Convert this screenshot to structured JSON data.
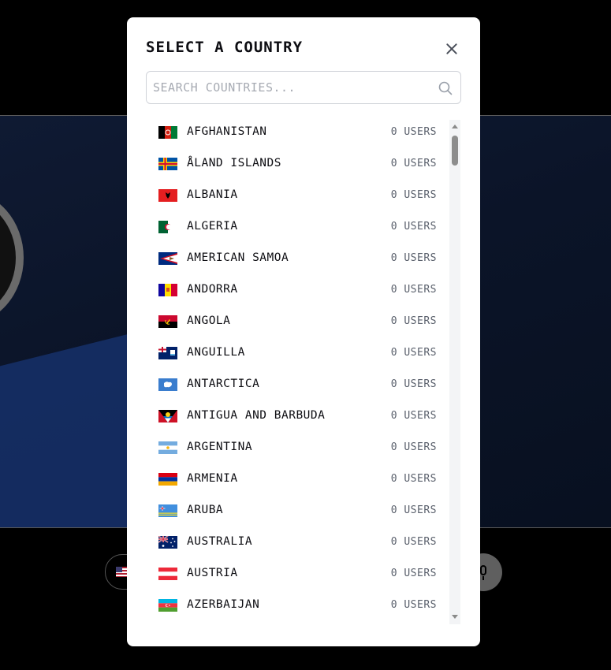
{
  "modal": {
    "title": "SELECT A COUNTRY",
    "search_placeholder": "SEARCH COUNTRIES..."
  },
  "countries": [
    {
      "name": "AFGHANISTAN",
      "users": "0 USERS"
    },
    {
      "name": "ÅLAND ISLANDS",
      "users": "0 USERS"
    },
    {
      "name": "ALBANIA",
      "users": "0 USERS"
    },
    {
      "name": "ALGERIA",
      "users": "0 USERS"
    },
    {
      "name": "AMERICAN SAMOA",
      "users": "0 USERS"
    },
    {
      "name": "ANDORRA",
      "users": "0 USERS"
    },
    {
      "name": "ANGOLA",
      "users": "0 USERS"
    },
    {
      "name": "ANGUILLA",
      "users": "0 USERS"
    },
    {
      "name": "ANTARCTICA",
      "users": "0 USERS"
    },
    {
      "name": "ANTIGUA AND BARBUDA",
      "users": "0 USERS"
    },
    {
      "name": "ARGENTINA",
      "users": "0 USERS"
    },
    {
      "name": "ARMENIA",
      "users": "0 USERS"
    },
    {
      "name": "ARUBA",
      "users": "0 USERS"
    },
    {
      "name": "AUSTRALIA",
      "users": "0 USERS"
    },
    {
      "name": "AUSTRIA",
      "users": "0 USERS"
    },
    {
      "name": "AZERBAIJAN",
      "users": "0 USERS"
    }
  ],
  "colors": {
    "modal_bg": "#ffffff",
    "text": "#0d0d12",
    "muted": "#595f6b",
    "page_bg": "#000000"
  }
}
